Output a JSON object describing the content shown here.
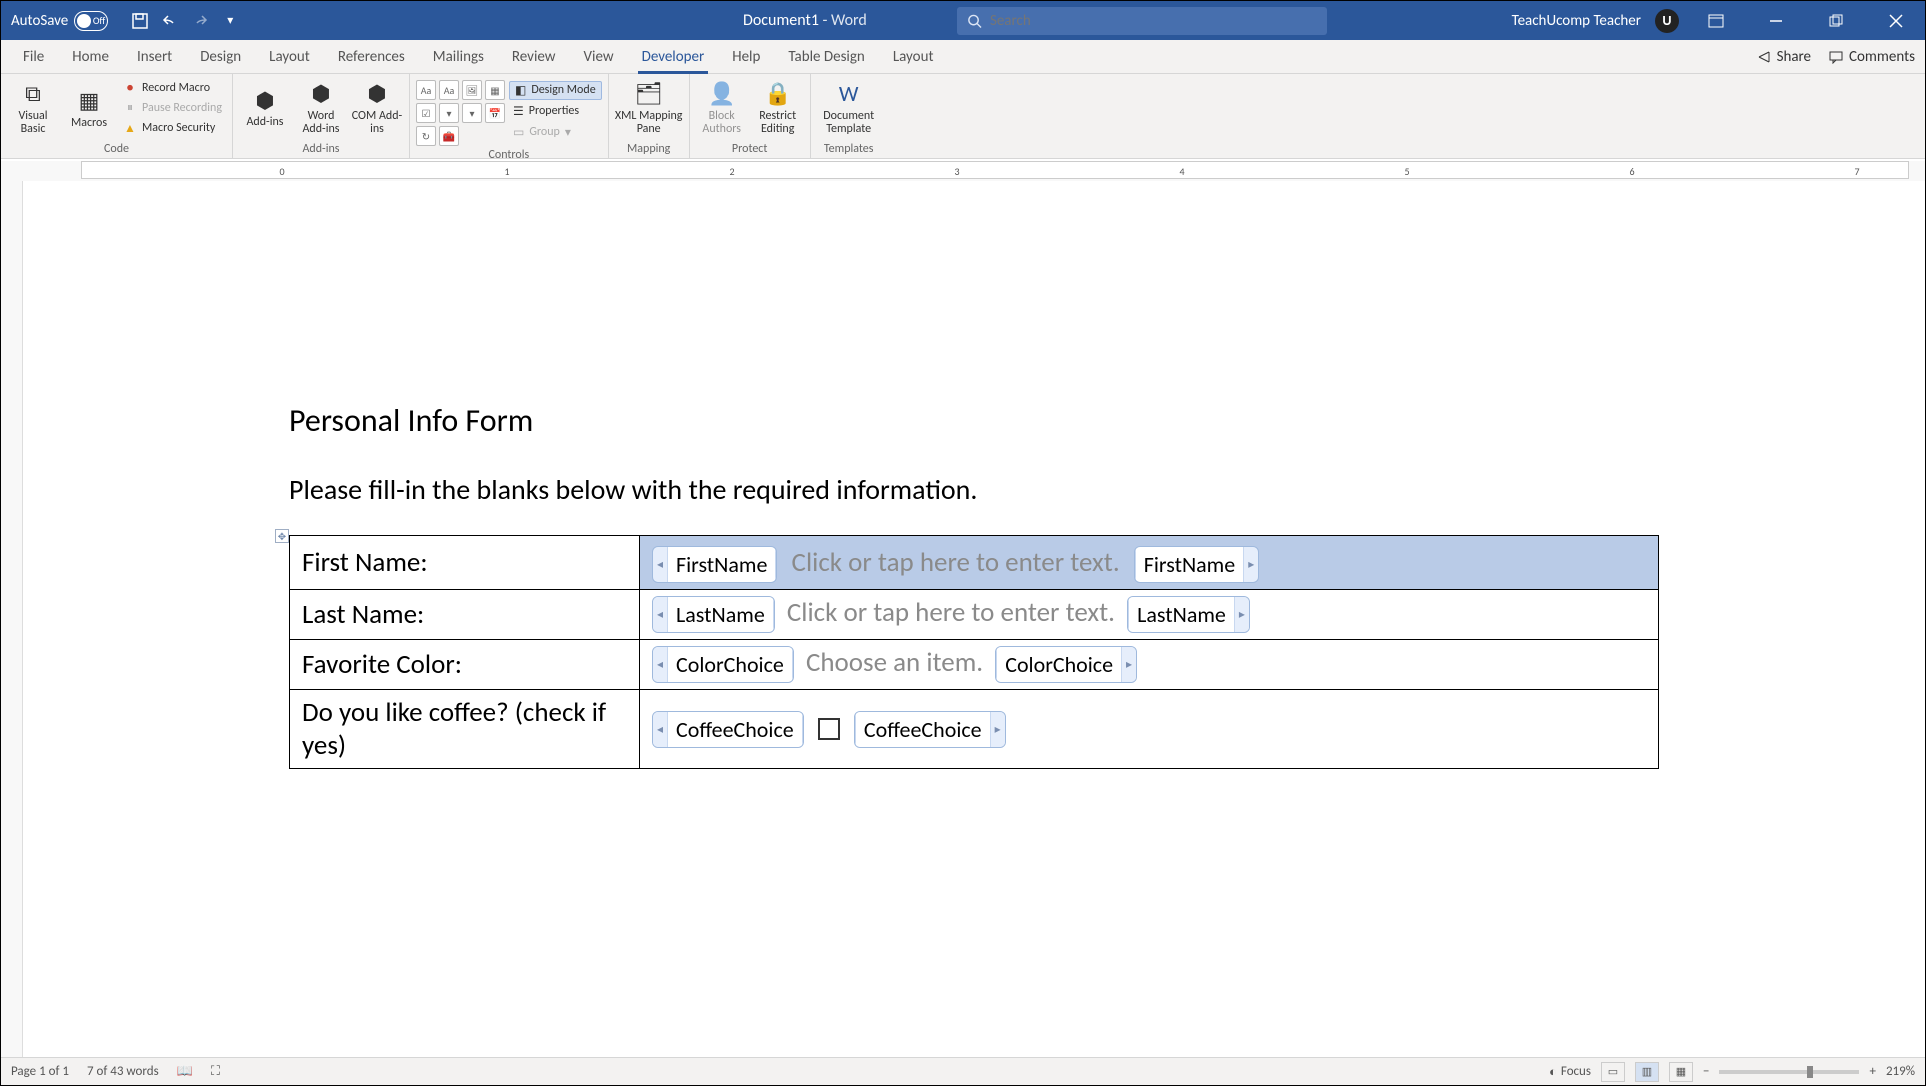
{
  "titlebar": {
    "autosave_label": "AutoSave",
    "autosave_state": "Off",
    "document_name": "Document1",
    "app_suffix": " - Word",
    "search_placeholder": "Search",
    "user_name": "TeachUcomp Teacher",
    "user_initial": "U"
  },
  "tabs": {
    "items": [
      "File",
      "Home",
      "Insert",
      "Design",
      "Layout",
      "References",
      "Mailings",
      "Review",
      "View",
      "Developer",
      "Help",
      "Table Design",
      "Layout"
    ],
    "active_index": 9,
    "share": "Share",
    "comments": "Comments"
  },
  "ribbon": {
    "code": {
      "visual_basic": "Visual Basic",
      "macros": "Macros",
      "record_macro": "Record Macro",
      "pause_recording": "Pause Recording",
      "macro_security": "Macro Security",
      "group_label": "Code"
    },
    "addins": {
      "addins": "Add-ins",
      "word_addins": "Word Add-ins",
      "com_addins": "COM Add-ins",
      "group_label": "Add-ins"
    },
    "controls": {
      "design_mode": "Design Mode",
      "properties": "Properties",
      "group": "Group",
      "group_label": "Controls"
    },
    "mapping": {
      "xml_mapping_pane": "XML Mapping Pane",
      "group_label": "Mapping"
    },
    "protect": {
      "block_authors": "Block Authors",
      "restrict_editing": "Restrict Editing",
      "group_label": "Protect"
    },
    "templates": {
      "document_template": "Document Template",
      "group_label": "Templates"
    }
  },
  "document": {
    "heading": "Personal Info Form",
    "intro": "Please fill-in the blanks below with the required information.",
    "rows": [
      {
        "label": "First Name:",
        "tag": "FirstName",
        "placeholder": "Click or tap here to enter text.",
        "type": "text",
        "selected": true
      },
      {
        "label": "Last Name:",
        "tag": "LastName",
        "placeholder": "Click or tap here to enter text.",
        "type": "text",
        "selected": false
      },
      {
        "label": "Favorite Color:",
        "tag": "ColorChoice",
        "placeholder": "Choose an item.",
        "type": "dropdown",
        "selected": false
      },
      {
        "label": "Do you like coffee? (check if yes)",
        "tag": "CoffeeChoice",
        "placeholder": "",
        "type": "checkbox",
        "selected": false
      }
    ]
  },
  "statusbar": {
    "page": "Page 1 of 1",
    "words": "7 of 43 words",
    "focus": "Focus",
    "zoom": "219%"
  }
}
